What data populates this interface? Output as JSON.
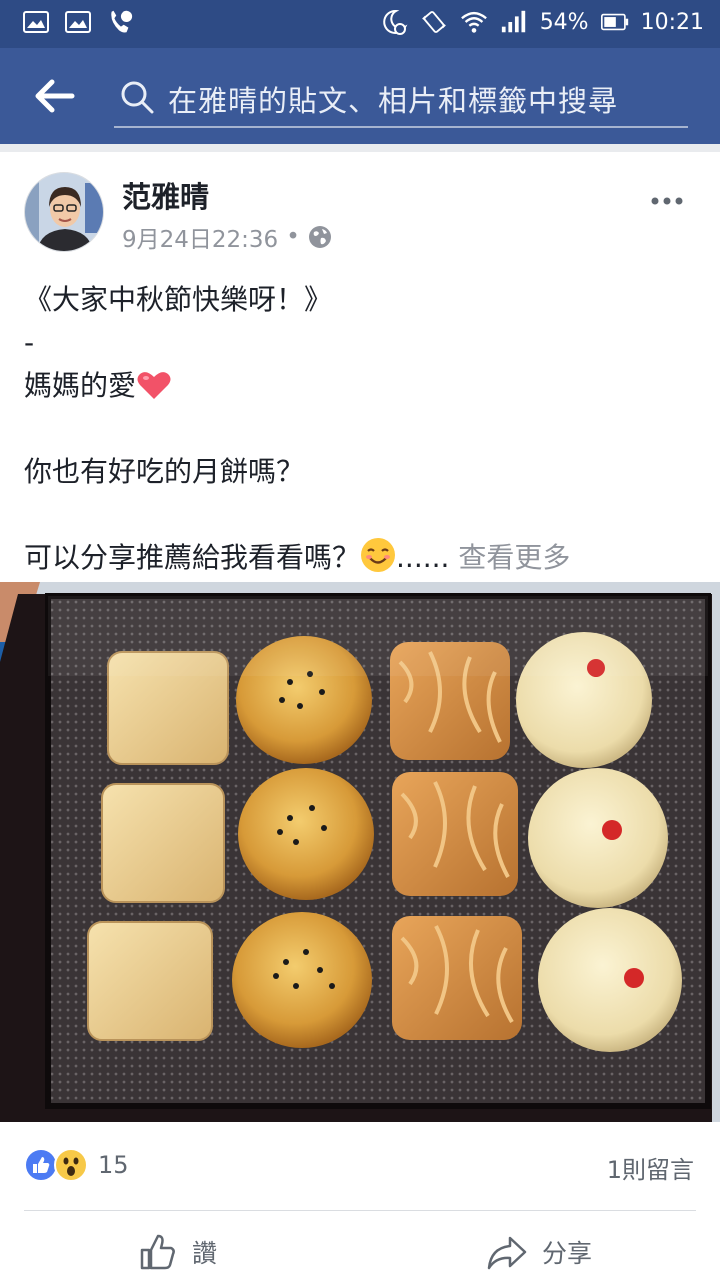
{
  "status_bar": {
    "battery": "54%",
    "time": "10:21"
  },
  "search": {
    "placeholder": "在雅晴的貼文、相片和標籤中搜尋"
  },
  "post": {
    "author": "范雅晴",
    "timestamp": "9月24日22:36",
    "separator": "•",
    "lines": [
      "《大家中秋節快樂呀！》",
      "-",
      "媽媽的愛",
      "",
      "你也有好吃的月餅嗎？",
      "",
      "可以分享推薦給我看看嗎？"
    ],
    "ellipsis": "......",
    "see_more": "查看更多"
  },
  "reactions": {
    "count": "15",
    "comments": "1則留言"
  },
  "actions": {
    "like": "讚",
    "share": "分享"
  },
  "colors": {
    "status_bar": "#2e4b85",
    "header": "#3b5998",
    "like_blue": "#4c7bf3",
    "wow_yellow": "#f7c948",
    "muted_text": "#90949c"
  }
}
